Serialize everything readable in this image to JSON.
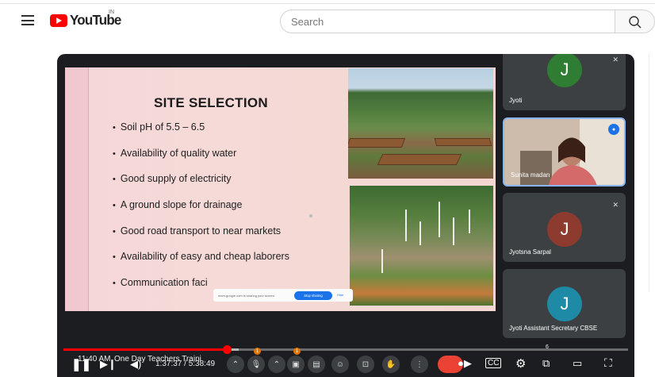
{
  "header": {
    "logo_text": "YouTube",
    "region_code": "IN",
    "search_placeholder": "Search"
  },
  "slide": {
    "title": "SITE SELECTION",
    "bullets": [
      "Soil pH of 5.5 – 6.5",
      "Availability of quality water",
      "Good supply of electricity",
      "A ground slope for drainage",
      "Good road transport to near markets",
      "Availability of easy and cheap laborers",
      "Communication faci"
    ],
    "share_notice": "meet.google.com is sharing your screen.",
    "stop_sharing": "Stop sharing",
    "hide": "Hide"
  },
  "participants": [
    {
      "name": "Jyoti",
      "initial": "J",
      "color": "#2e7d32"
    },
    {
      "name": "Sunita madan",
      "initial": "",
      "color": "#d7c6b8"
    },
    {
      "name": "Jyotsna Sarpal",
      "initial": "J",
      "color": "#8d3b2e"
    },
    {
      "name": "Jyoti Assistant Secretary CBSE",
      "initial": "J",
      "color": "#1e8aa6"
    }
  ],
  "player": {
    "progress": 0.29,
    "buffered": 0.31,
    "time_current": "1:37:37",
    "time_total": "5:38:49",
    "time_display": "1:37:37 / 5:38:49",
    "overlay_clock": "11:40 AM",
    "overlay_title": "One Day Teachers Traini",
    "meet_counter": "6",
    "badge_count": "1"
  },
  "colors": {
    "accent_red": "#ff0000",
    "meet_blue": "#1a73e8"
  }
}
